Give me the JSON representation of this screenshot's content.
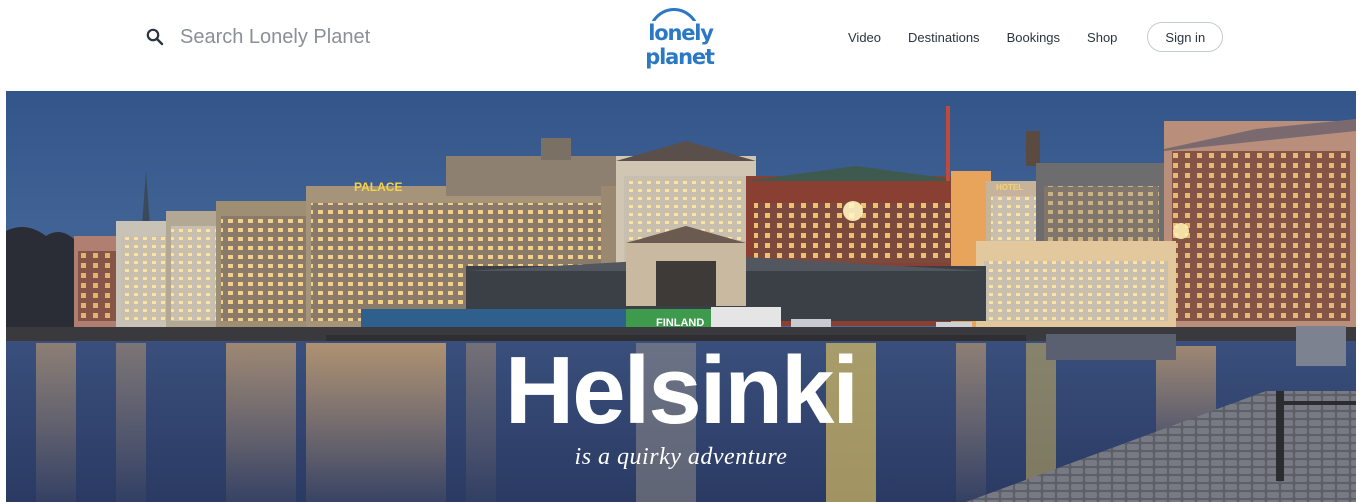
{
  "header": {
    "search": {
      "placeholder": "Search Lonely Planet",
      "icon": "search-icon"
    },
    "logo": {
      "text": "lonely planet",
      "color": "#2b78c4"
    },
    "nav": [
      {
        "label": "Video"
      },
      {
        "label": "Destinations"
      },
      {
        "label": "Bookings"
      },
      {
        "label": "Shop"
      }
    ],
    "signin_label": "Sign in"
  },
  "hero": {
    "title": "Helsinki",
    "subtitle": "is a quirky adventure",
    "signs": {
      "palace": "PALACE",
      "finland": "FINLAND",
      "hotel": "HOTEL"
    }
  }
}
